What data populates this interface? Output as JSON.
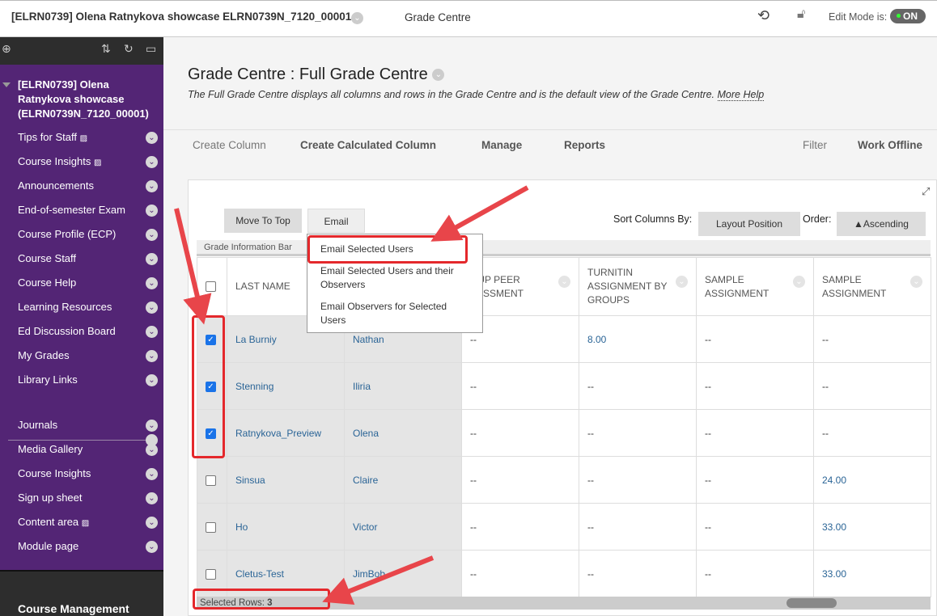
{
  "header": {
    "course": "[ELRN0739] Olena Ratnykova showcase ELRN0739N_7120_00001",
    "section": "Grade Centre",
    "edit_mode_label": "Edit Mode is:",
    "edit_mode_value": "ON"
  },
  "sidebar": {
    "course_title": "[ELRN0739] Olena Ratnykova showcase (ELRN0739N_7120_00001)",
    "items": [
      {
        "label": "Tips for Staff"
      },
      {
        "label": "Course Insights"
      },
      {
        "label": "Announcements"
      },
      {
        "label": "End-of-semester Exam"
      },
      {
        "label": "Course Profile (ECP)"
      },
      {
        "label": "Course Staff"
      },
      {
        "label": "Course Help"
      },
      {
        "label": "Learning Resources"
      },
      {
        "label": "Ed Discussion Board"
      },
      {
        "label": "My Grades"
      },
      {
        "label": "Library Links"
      }
    ],
    "items2": [
      {
        "label": "Journals"
      },
      {
        "label": "Media Gallery"
      },
      {
        "label": "Course Insights"
      },
      {
        "label": "Sign up sheet"
      },
      {
        "label": "Content area"
      },
      {
        "label": "Module page"
      }
    ],
    "course_management": "Course Management"
  },
  "page": {
    "title": "Grade Centre : Full Grade Centre",
    "description": "The Full Grade Centre displays all columns and rows in the Grade Centre and is the default view of the Grade Centre.",
    "more_help": "More Help"
  },
  "toolbar": {
    "create_column": "Create Column",
    "create_calc": "Create Calculated Column",
    "manage": "Manage",
    "reports": "Reports",
    "filter": "Filter",
    "work_offline": "Work Offline"
  },
  "controls": {
    "move_to_top": "Move To Top",
    "email": "Email",
    "sort_by_label": "Sort Columns By:",
    "sort_by_value": "Layout Position",
    "order_label": "Order:",
    "order_value": "▲Ascending",
    "grade_info_bar": "Grade Information Bar"
  },
  "email_menu": [
    "Email Selected Users",
    "Email Selected Users and their Observers",
    "Email Observers for Selected Users"
  ],
  "table": {
    "columns": [
      "LAST NAME",
      "FIRST NAME",
      "GROUP PEER ASSESSMENT",
      "TURNITIN ASSIGNMENT BY GROUPS",
      "SAMPLE ASSIGNMENT",
      "SAMPLE ASSIGNMENT"
    ],
    "visible_header_fragment": "OUP PEER SESSMENT",
    "rows": [
      {
        "checked": true,
        "last": "La Burniy",
        "first": "Nathan",
        "c1": "--",
        "c2": "8.00",
        "c3": "--",
        "c4": "--"
      },
      {
        "checked": true,
        "last": "Stenning",
        "first": "Iliria",
        "c1": "--",
        "c2": "--",
        "c3": "--",
        "c4": "--"
      },
      {
        "checked": true,
        "last": "Ratnykova_Preview",
        "first": "Olena",
        "c1": "--",
        "c2": "--",
        "c3": "--",
        "c4": "--"
      },
      {
        "checked": false,
        "last": "Sinsua",
        "first": "Claire",
        "c1": "--",
        "c2": "--",
        "c3": "--",
        "c4": "24.00"
      },
      {
        "checked": false,
        "last": "Ho",
        "first": "Victor",
        "c1": "--",
        "c2": "--",
        "c3": "--",
        "c4": "33.00"
      },
      {
        "checked": false,
        "last": "Cletus-Test",
        "first": "JimBob",
        "c1": "--",
        "c2": "--",
        "c3": "--",
        "c4": "33.00"
      }
    ]
  },
  "status": {
    "selected_rows_label": "Selected Rows:",
    "selected_rows_count": "3"
  },
  "colors": {
    "sidebar": "#532575",
    "highlight": "#e4282c",
    "link": "#2a6496"
  }
}
